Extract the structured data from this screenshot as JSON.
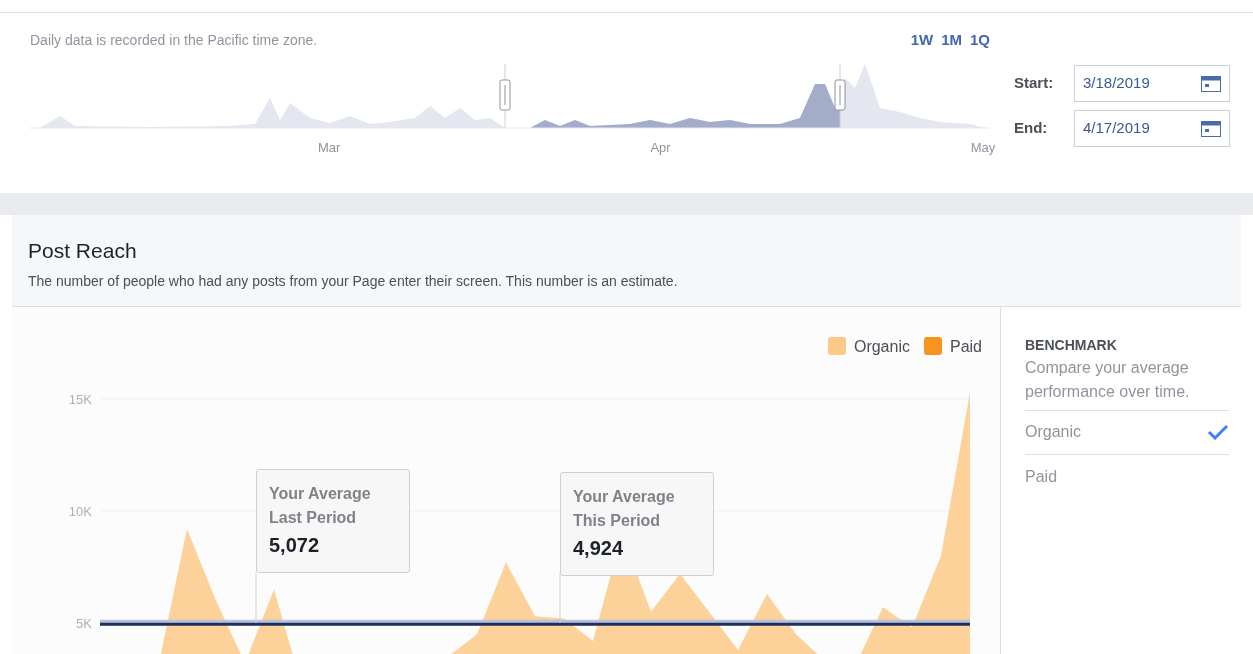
{
  "range_panel": {
    "note": "Daily data is recorded in the Pacific time zone.",
    "presets": [
      "1W",
      "1M",
      "1Q"
    ],
    "months": [
      "Mar",
      "Apr",
      "May"
    ],
    "start": {
      "label": "Start:",
      "value": "3/18/2019"
    },
    "end": {
      "label": "End:",
      "value": "4/17/2019"
    }
  },
  "post_reach": {
    "title": "Post Reach",
    "description": "The number of people who had any posts from your Page enter their screen. This number is an estimate.",
    "chart": {
      "legend": [
        {
          "name": "Organic",
          "color": "#fcc988"
        },
        {
          "name": "Paid",
          "color": "#f7931e"
        }
      ],
      "y_axis_labels": [
        "15K",
        "10K",
        "5K"
      ]
    },
    "callouts": [
      {
        "label": "Your Average Last Period",
        "value": "5,072"
      },
      {
        "label": "Your Average This Period",
        "value": "4,924"
      }
    ],
    "benchmark": {
      "title": "BENCHMARK",
      "description": "Compare your average performance over time.",
      "options": [
        {
          "label": "Organic",
          "selected": true
        },
        {
          "label": "Paid",
          "selected": false
        }
      ]
    }
  }
}
